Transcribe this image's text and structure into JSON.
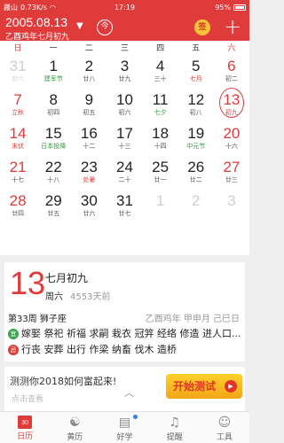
{
  "status_bar": {
    "carrier": "搬山",
    "speed": "0.73K/s",
    "time": "17:19",
    "battery": "95%"
  },
  "header": {
    "date": "2005.08.13",
    "lunar": "乙酉鸡年七月初九",
    "jin_icon": "今",
    "coin_icon": "签",
    "accent": "#e03b3b"
  },
  "week_header": [
    "日",
    "一",
    "二",
    "三",
    "四",
    "五",
    "六"
  ],
  "days": [
    {
      "num": "31",
      "sub": "廿六",
      "other": true
    },
    {
      "num": "1",
      "sub": "建军节",
      "sub_color": "green"
    },
    {
      "num": "2",
      "sub": "廿八"
    },
    {
      "num": "3",
      "sub": "廿九"
    },
    {
      "num": "4",
      "sub": "三十"
    },
    {
      "num": "5",
      "sub": "七月",
      "sub_color": "red"
    },
    {
      "num": "6",
      "sub": "初二"
    },
    {
      "num": "7",
      "sub": "立秋",
      "sub_color": "red"
    },
    {
      "num": "8",
      "sub": "初四"
    },
    {
      "num": "9",
      "sub": "初五"
    },
    {
      "num": "10",
      "sub": "初六"
    },
    {
      "num": "11",
      "sub": "七夕",
      "sub_color": "green"
    },
    {
      "num": "12",
      "sub": "初八"
    },
    {
      "num": "13",
      "sub": "初九",
      "today": true
    },
    {
      "num": "14",
      "sub": "末伏",
      "sub_color": "red"
    },
    {
      "num": "15",
      "sub": "日本投降",
      "sub_color": "green"
    },
    {
      "num": "16",
      "sub": "十二"
    },
    {
      "num": "17",
      "sub": "十三"
    },
    {
      "num": "18",
      "sub": "十四"
    },
    {
      "num": "19",
      "sub": "中元节",
      "sub_color": "green"
    },
    {
      "num": "20",
      "sub": "十六"
    },
    {
      "num": "21",
      "sub": "十七"
    },
    {
      "num": "22",
      "sub": "十八"
    },
    {
      "num": "23",
      "sub": "处暑",
      "sub_color": "red"
    },
    {
      "num": "24",
      "sub": "二十"
    },
    {
      "num": "25",
      "sub": "廿一"
    },
    {
      "num": "26",
      "sub": "廿二"
    },
    {
      "num": "27",
      "sub": "廿三"
    },
    {
      "num": "28",
      "sub": "廿四"
    },
    {
      "num": "29",
      "sub": "廿五"
    },
    {
      "num": "30",
      "sub": "廿六"
    },
    {
      "num": "31",
      "sub": "廿七"
    },
    {
      "num": "1",
      "sub": "",
      "other": true
    },
    {
      "num": "2",
      "sub": "",
      "other": true
    },
    {
      "num": "3",
      "sub": "",
      "other": true
    }
  ],
  "detail": {
    "day": "13",
    "lunar_day": "七月初九",
    "weekday": "周六",
    "ago": "4553天前",
    "week_info": "第33周  狮子座",
    "ganzhi": "乙酉鸡年 甲申月 己巳日",
    "yi_label": "宜",
    "yi": "嫁娶 祭祀 祈福 求嗣 栽衣 冠笄 经络 修造 进人口...",
    "ji_label": "忌",
    "ji": "行丧 安葬 出行 作梁 纳畜 伐木 造桥"
  },
  "promo": {
    "text": "测测你2018如何富起来!",
    "more": "点击查看",
    "up": "︿",
    "button": "开始测试"
  },
  "bottom_nav": [
    {
      "label": "日历",
      "icon": "calendar-icon",
      "active": true,
      "badge": "30"
    },
    {
      "label": "黄历",
      "icon": "yinyang-icon"
    },
    {
      "label": "好学",
      "icon": "book-icon",
      "dot": true
    },
    {
      "label": "提醒",
      "icon": "bell-icon"
    },
    {
      "label": "工具",
      "icon": "user-icon"
    }
  ]
}
